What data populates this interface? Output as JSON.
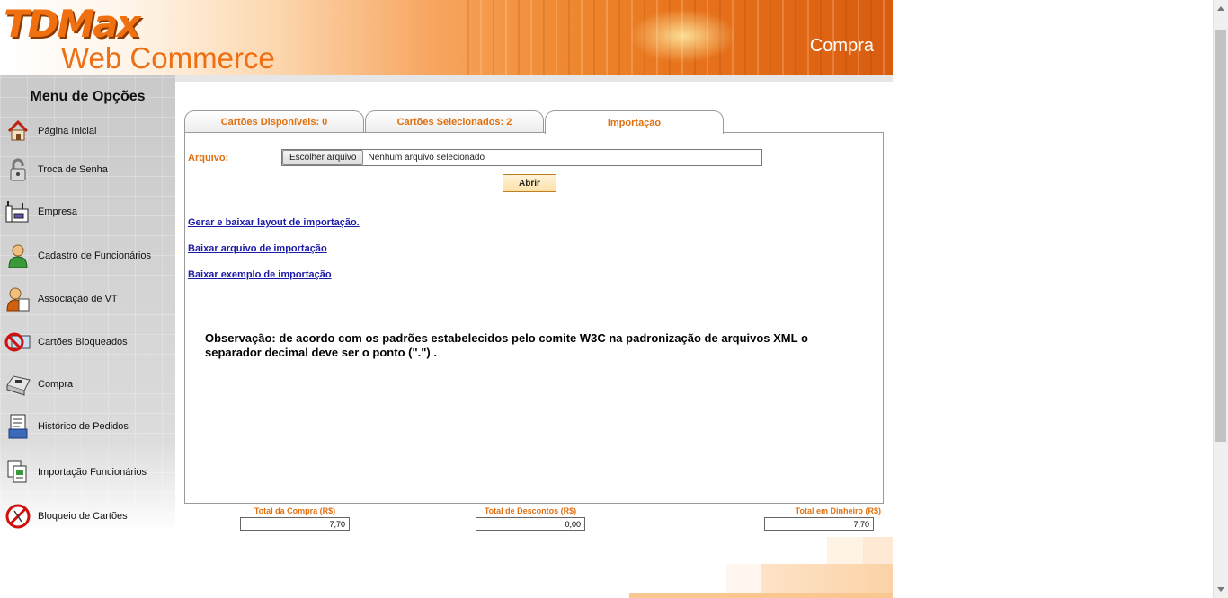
{
  "header": {
    "logo_main": "TDMax",
    "logo_sub": "Web Commerce",
    "page_title": "Compra"
  },
  "sidebar": {
    "title": "Menu de Opções",
    "items": [
      {
        "label": "Página Inicial",
        "icon": "home-icon"
      },
      {
        "label": "Troca de Senha",
        "icon": "padlock-icon"
      },
      {
        "label": "Empresa",
        "icon": "factory-icon"
      },
      {
        "label": "Cadastro de Funcionários",
        "icon": "user-icon"
      },
      {
        "label": "Associação de VT",
        "icon": "user-card-icon"
      },
      {
        "label": "Cartões Bloqueados",
        "icon": "blocked-card-icon"
      },
      {
        "label": "Compra",
        "icon": "cash-register-icon"
      },
      {
        "label": "Histórico de Pedidos",
        "icon": "order-history-icon"
      },
      {
        "label": "Importação Funcionários",
        "icon": "documents-icon"
      },
      {
        "label": "Bloqueio de Cartões",
        "icon": "no-card-icon"
      }
    ]
  },
  "tabs": [
    {
      "label": "Cartões Disponíveis: 0"
    },
    {
      "label": "Cartões Selecionados: 2"
    },
    {
      "label": "Importação",
      "active": true
    }
  ],
  "import": {
    "file_label": "Arquivo:",
    "file_button": "Escolher arquivo",
    "file_status": "Nenhum arquivo selecionado",
    "open_button": "Abrir",
    "links": [
      "Gerar e baixar layout de importação.",
      "Baixar arquivo de importação",
      "Baixar exemplo de importação"
    ],
    "observation": "Observação: de acordo com os padrões estabelecidos pelo comite W3C na padronização de arquivos XML o separador decimal deve ser o ponto (\".\") ."
  },
  "totals": {
    "compra_label": "Total da Compra (R$)",
    "compra_value": "7,70",
    "descontos_label": "Total de Descontos (R$)",
    "descontos_value": "0,00",
    "dinheiro_label": "Total em Dinheiro (R$)",
    "dinheiro_value": "7,70"
  },
  "colors": {
    "accent": "#e07010",
    "link": "#1a1aa6"
  }
}
